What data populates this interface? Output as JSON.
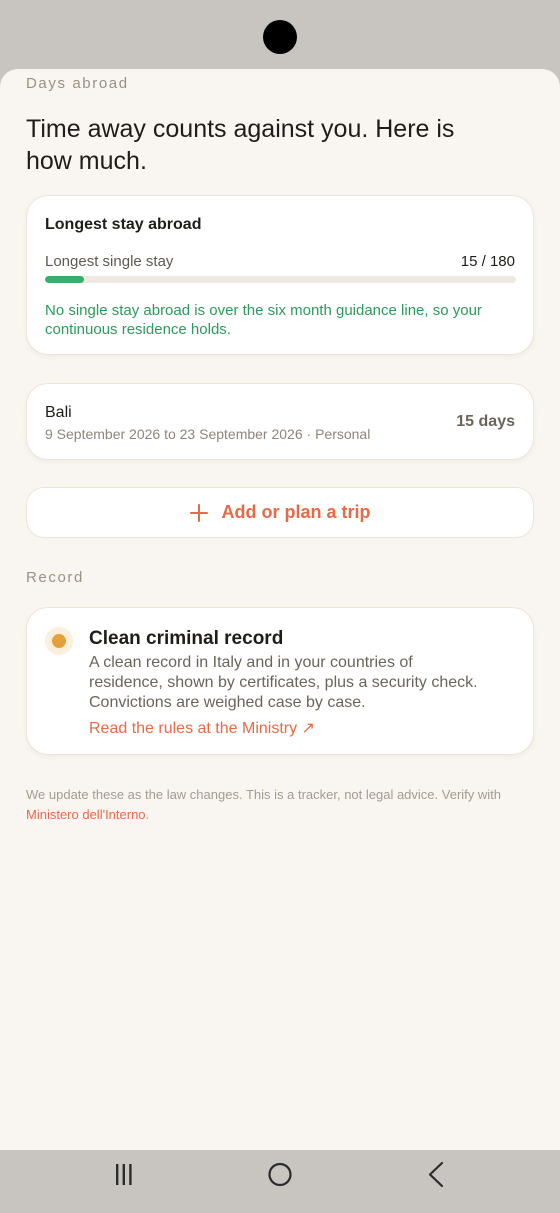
{
  "days_abroad": {
    "section_label": "Days abroad",
    "headline": "Time away counts against you. Here is how much."
  },
  "longest_stay": {
    "title": "Longest stay abroad",
    "row_label": "Longest single stay",
    "value_text": "15 / 180",
    "progress_fraction": 0.0833,
    "progress_color": "#3aad6e",
    "note": "No single stay abroad is over the six month guidance line, so your continuous residence holds."
  },
  "trip": {
    "name": "Bali",
    "details": "9 September 2026 to 23 September 2026 · Personal",
    "days": "15 days"
  },
  "add_trip": {
    "icon": "plus-icon",
    "label": "Add or plan a trip"
  },
  "record": {
    "section_label": "Record",
    "status_color": "#e6a03a",
    "title": "Clean criminal record",
    "description": "A clean record in Italy and in your countries of residence, shown by certificates, plus a security check. Convictions are weighed case by case.",
    "link_label": "Read the rules at the Ministry ↗"
  },
  "footer": {
    "note": "We update these as the law changes. This is a tracker, not legal advice. Verify with ",
    "link_label": "Ministero dell'Interno",
    "suffix": "."
  },
  "colors": {
    "accent": "#e56a47",
    "success": "#2c9a5d",
    "background": "#f9f6f1"
  }
}
